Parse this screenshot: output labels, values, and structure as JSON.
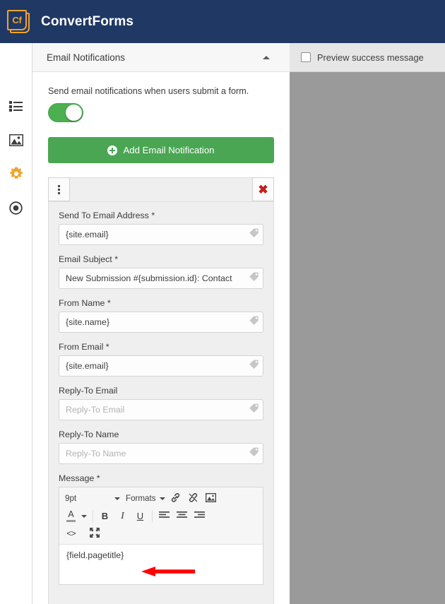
{
  "topbar": {
    "logo_text": "Cf",
    "brand": "ConvertForms"
  },
  "sidebar": {
    "items": [
      {
        "icon": "list-icon",
        "label": "Fields"
      },
      {
        "icon": "image-icon",
        "label": "Media"
      },
      {
        "icon": "gear-icon",
        "label": "Settings"
      },
      {
        "icon": "radio-circle-icon",
        "label": "Publish"
      }
    ],
    "active_index": 2,
    "active_color": "#f0a22e"
  },
  "panel": {
    "title": "Email Notifications",
    "collapse_icon": "chevron-up-icon",
    "helper_text": "Send email notifications when users submit a form.",
    "toggle": {
      "state": "on",
      "color": "#4caf50"
    },
    "add_button": {
      "label": "Add Email Notification",
      "icon": "plus-circle-icon",
      "color": "#4aa653"
    }
  },
  "notification_card": {
    "handle_icon": "vertical-dots-icon",
    "delete_icon": "close-x-icon",
    "delete_color": "#c0201e",
    "fields": [
      {
        "label": "Send To Email Address *",
        "value": "{site.email}",
        "placeholder": "",
        "icon": "tag-icon"
      },
      {
        "label": "Email Subject *",
        "value": "New Submission #{submission.id}: Contact",
        "placeholder": "",
        "icon": "tag-icon"
      },
      {
        "label": "From Name *",
        "value": "{site.name}",
        "placeholder": "",
        "icon": "tag-icon"
      },
      {
        "label": "From Email *",
        "value": "{site.email}",
        "placeholder": "",
        "icon": "tag-icon"
      },
      {
        "label": "Reply-To Email",
        "value": "",
        "placeholder": "Reply-To Email",
        "icon": "tag-icon"
      },
      {
        "label": "Reply-To Name",
        "value": "",
        "placeholder": "Reply-To Name",
        "icon": "tag-icon"
      }
    ],
    "message": {
      "label": "Message *",
      "toolbar": {
        "font_size": "9pt",
        "formats": "Formats",
        "row1_icons": [
          "link-icon",
          "unlink-icon",
          "image-icon"
        ],
        "row2": [
          "text-color-icon",
          "bold-icon",
          "italic-icon",
          "underline-icon",
          "align-left-icon",
          "align-center-icon",
          "align-right-icon"
        ],
        "row3": [
          "source-code-icon",
          "fullscreen-icon"
        ],
        "bold_label": "B",
        "italic_label": "I",
        "underline_label": "U",
        "color_label": "A",
        "code_label": "<>"
      },
      "content": "{field.pagetitle}"
    }
  },
  "annotation": {
    "arrow": {
      "direction": "left",
      "color": "#fe0000"
    }
  },
  "preview": {
    "checkbox_checked": false,
    "label": "Preview success message"
  }
}
